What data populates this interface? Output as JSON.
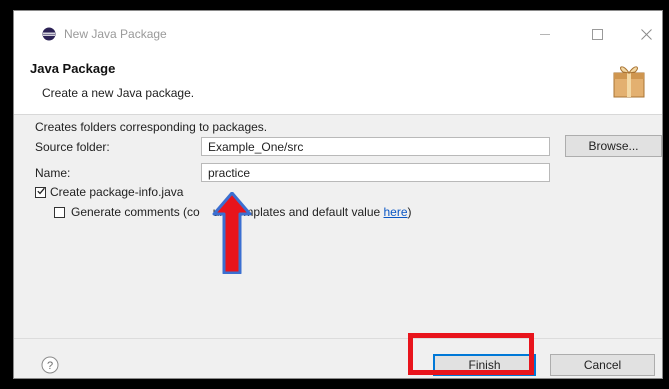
{
  "window": {
    "title": "New Java Package"
  },
  "header": {
    "title": "Java Package",
    "description": "Create a new Java package."
  },
  "body": {
    "intro": "Creates folders corresponding to packages.",
    "source_folder": {
      "label": "Source folder:",
      "value": "Example_One/src",
      "browse_label": "Browse..."
    },
    "name": {
      "label": "Name:",
      "value": "practice"
    },
    "create_package_info": {
      "label": "Create package-info.java",
      "checked": true
    },
    "generate_comments": {
      "label_prefix": "Generate comments (co",
      "label_middle": "ure templates and default value ",
      "link_text": "here",
      "label_suffix": ")",
      "checked": false
    }
  },
  "footer": {
    "finish_label": "Finish",
    "cancel_label": "Cancel"
  },
  "icons": {
    "app": "eclipse-icon",
    "header": "package-icon",
    "help": "help-icon"
  },
  "colors": {
    "highlight_red": "#e8141c",
    "arrow_blue": "#3b6fd1",
    "link_blue": "#0b57c5",
    "focus_blue": "#0078d7"
  }
}
